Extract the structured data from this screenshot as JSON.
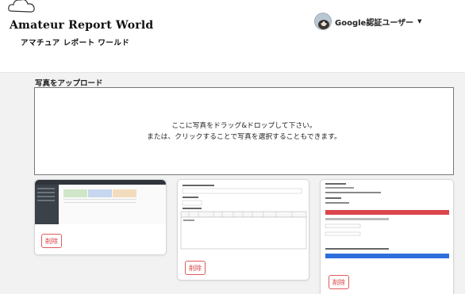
{
  "header": {
    "logo_title": "Amateur Report World",
    "logo_subtitle": "アマチュア レポート ワールド",
    "user_name": "Google認証ユーザー",
    "caret": "▼"
  },
  "upload": {
    "title": "写真をアップロード",
    "line1": "ここに写真をドラッグ&ドロップして下さい。",
    "line2": "または、クリックすることで写真を選択することもできます。"
  },
  "cards": [
    {
      "delete_label": "削除"
    },
    {
      "delete_label": "削除"
    },
    {
      "delete_label": "削除"
    }
  ],
  "colors": {
    "page_bg": "#f2f2f2",
    "delete_red": "#d63c3c",
    "thumb3_red_bar": "#d9464b",
    "thumb3_blue_bar": "#2e6fdc",
    "thumb1_dark": "#2f353b"
  }
}
